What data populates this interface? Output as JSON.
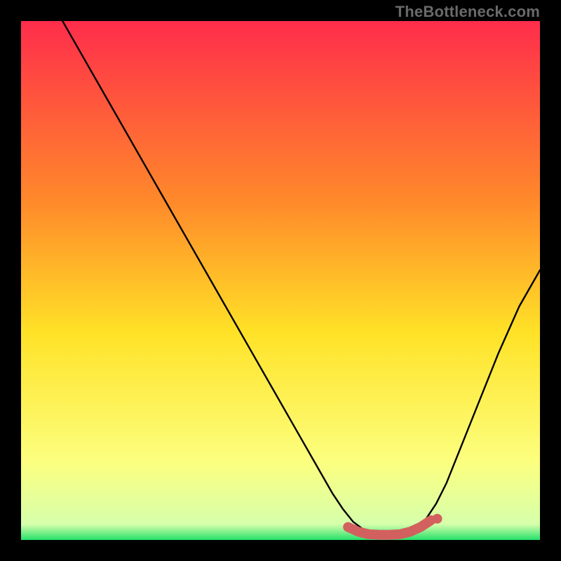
{
  "watermark": "TheBottleneck.com",
  "colors": {
    "bg_black": "#000000",
    "gradient_top": "#ff2d4b",
    "gradient_mid_upper": "#ff8a2a",
    "gradient_mid": "#ffe227",
    "gradient_lower": "#fcff7f",
    "gradient_bottom": "#25e06a",
    "curve": "#000000",
    "marker": "#d2605e"
  },
  "chart_data": {
    "type": "line",
    "title": "",
    "xlabel": "",
    "ylabel": "",
    "xlim": [
      0,
      100
    ],
    "ylim": [
      0,
      100
    ],
    "grid": false,
    "legend": null,
    "series": [
      {
        "name": "bottleneck-curve",
        "x": [
          8,
          12,
          16,
          20,
          24,
          28,
          32,
          36,
          40,
          44,
          48,
          52,
          56,
          60,
          62,
          64,
          66,
          68,
          70,
          72,
          74,
          76,
          78,
          80,
          82,
          84,
          88,
          92,
          96,
          100
        ],
        "y": [
          100,
          93,
          86,
          79,
          72,
          65,
          58,
          51,
          44,
          37,
          30,
          23,
          16,
          9,
          6,
          3.5,
          2,
          1.2,
          1,
          1,
          1.2,
          2.2,
          4,
          7,
          11,
          16,
          26,
          36,
          45,
          52
        ]
      }
    ],
    "markers": {
      "name": "highlight-segment",
      "x": [
        63,
        65,
        67,
        69,
        71,
        73,
        75,
        77,
        79
      ],
      "y": [
        2.5,
        1.6,
        1.1,
        1.0,
        1.0,
        1.1,
        1.6,
        2.5,
        3.8
      ]
    }
  }
}
